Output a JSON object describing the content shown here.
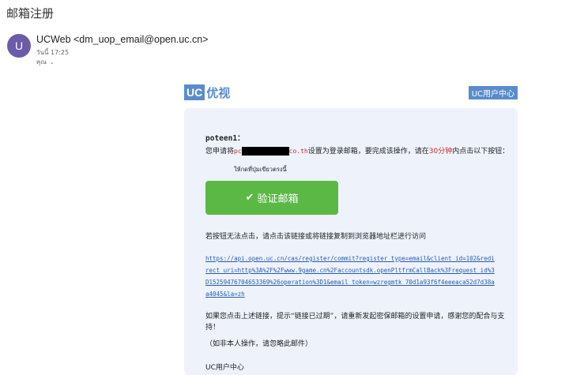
{
  "email": {
    "subject": "邮箱注册",
    "avatar_letter": "U",
    "sender": "UCWeb <dm_uop_email@open.uc.cn>",
    "time": "วันนี้ 17:25",
    "to": "คุณ"
  },
  "brand": {
    "logo_uc": "UC",
    "logo_text": "优视",
    "center_badge": "UC用户中心",
    "accent_color": "#5a8ccc"
  },
  "body": {
    "greeting": "poteen1：",
    "line1_prefix": "您申请将",
    "line1_email_start": "pc",
    "line1_email_end": "co.th",
    "line1_mid": "设置为登录邮箱，要完成该操作，请在",
    "line1_highlight": "30分钟",
    "line1_suffix": "内点击以下按钮：",
    "hint_thai": "ให้กดที่ปุ่มเขียวตรงนี้",
    "button_label": "验证邮箱",
    "button_color": "#5cb845",
    "link_instructions": "若按钮无法点击，请点击该链接或将链接复制到浏览器地址栏进行访问",
    "link_url": "https://api.open.uc.cn/cas/register/commit?register_type=email&client_id=102&redirect_uri=http%3A%2F%2Fwww.9game.cn%2Faccountsdk.openPltfrmCallBack%3Frequest_id%3D15259476704653369%26operation%3D1&email_token=wzregmtk_70d1a93f6f4eeeaca52d7d38aa4045&la=zh",
    "expired_note": "如果您点击上述链接，提示“链接已过期”，请重新发起密保邮箱的设置申请，感谢您的配合与支持！",
    "not_you": "（如非本人操作，请忽略此邮件）",
    "signature": "UC用户中心"
  }
}
